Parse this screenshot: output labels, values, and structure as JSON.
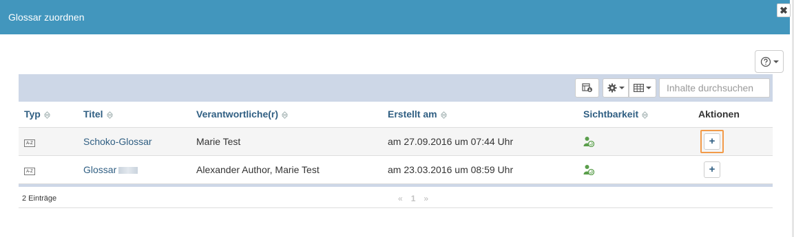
{
  "dialog": {
    "title": "Glossar zuordnen",
    "close_symbol": "✖"
  },
  "toolbar": {
    "search_placeholder": "Inhalte durchsuchen"
  },
  "table": {
    "columns": [
      "Typ",
      "Titel",
      "Verantwortliche(r)",
      "Erstellt am",
      "Sichtbarkeit",
      "Aktionen"
    ],
    "rows": [
      {
        "type_icon": "glossary-icon",
        "type_text": "A-Z",
        "title": "Schoko-Glossar",
        "owners": "Marie Test",
        "created": "am 27.09.2016 um 07:44 Uhr",
        "visibility_icon": "group-visibility-icon",
        "action": "+"
      },
      {
        "type_icon": "glossary-icon",
        "type_text": "A-Z",
        "title": "Glossar",
        "owners": "Alexander Author, Marie Test",
        "created": "am 23.03.2016 um 08:59 Uhr",
        "visibility_icon": "group-visibility-icon",
        "action": "+"
      }
    ]
  },
  "footer": {
    "count": "2 Einträge",
    "prev": "«",
    "page": "1",
    "next": "»"
  },
  "colors": {
    "header_bg": "#4296bd",
    "toolbar_bg": "#cdd7e7",
    "link": "#2f5e82",
    "highlight": "#f29a48",
    "visibility_icon": "#5a9e4b"
  }
}
